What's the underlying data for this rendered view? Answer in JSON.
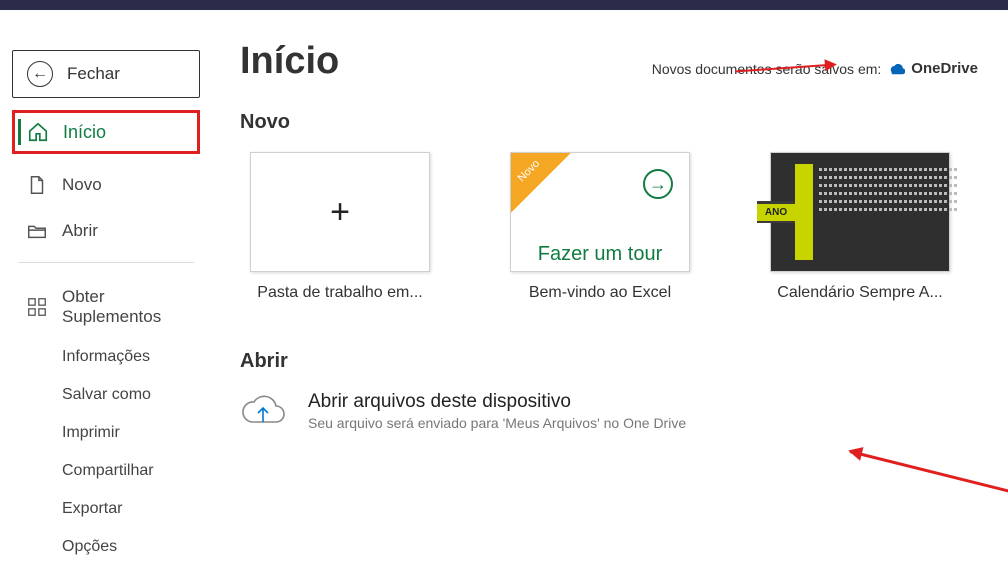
{
  "sidebar": {
    "close": "Fechar",
    "home": "Início",
    "new": "Novo",
    "open": "Abrir",
    "addins": "Obter Suplementos",
    "info": "Informações",
    "saveas": "Salvar como",
    "print": "Imprimir",
    "share": "Compartilhar",
    "export": "Exportar",
    "options": "Opções"
  },
  "page": {
    "title": "Início",
    "save_notice": "Novos documentos serão salvos em:",
    "save_target": "OneDrive",
    "section_new": "Novo",
    "section_open": "Abrir"
  },
  "templates": {
    "blank": {
      "label": "Pasta de trabalho em..."
    },
    "welcome": {
      "badge": "Novo",
      "text": "Fazer um tour",
      "label": "Bem-vindo ao Excel"
    },
    "calendar": {
      "year": "ANO",
      "label": "Calendário Sempre A..."
    }
  },
  "open": {
    "title": "Abrir arquivos deste dispositivo",
    "subtitle": "Seu arquivo será enviado para 'Meus Arquivos' no One Drive"
  }
}
